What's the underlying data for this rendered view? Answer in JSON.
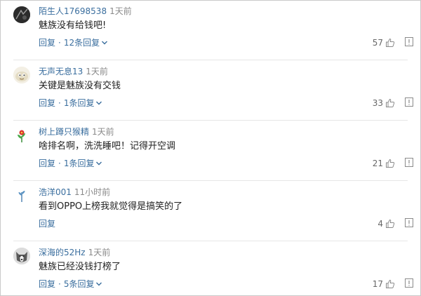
{
  "colors": {
    "username": "#3a6e9e",
    "link": "#3a6e9e",
    "time": "#8a8a8a",
    "text": "#222222",
    "divider": "#e6e6e6"
  },
  "comments": [
    {
      "username": "陌生人17698538",
      "time": "1天前",
      "text": "魅族没有给钱吧!",
      "reply_label": "回复",
      "separator": "·",
      "replies_label": "12条回复",
      "likes": "57",
      "avatar_icon": "dark-profile-avatar-icon"
    },
    {
      "username": "无声无息13",
      "time": "1天前",
      "text": "关键是魅族没有交钱",
      "reply_label": "回复",
      "separator": "·",
      "replies_label": "1条回复",
      "likes": "33",
      "avatar_icon": "cartoon-avatar-icon"
    },
    {
      "username": "树上蹲只猴精",
      "time": "1天前",
      "text": "啥排名啊，洗洗睡吧！记得开空调",
      "reply_label": "回复",
      "separator": "·",
      "replies_label": "1条回复",
      "likes": "21",
      "avatar_icon": "flower-avatar-icon"
    },
    {
      "username": "浩洋001",
      "time": "11小时前",
      "text": "看到OPPO上榜我就觉得是搞笑的了",
      "reply_label": "回复",
      "likes": "4",
      "avatar_icon": "leaf-avatar-icon"
    },
    {
      "username": "深海的52Hz",
      "time": "1天前",
      "text": "魅族已经没钱打榜了",
      "reply_label": "回复",
      "separator": "·",
      "replies_label": "5条回复",
      "likes": "17",
      "avatar_icon": "husky-avatar-icon"
    }
  ]
}
